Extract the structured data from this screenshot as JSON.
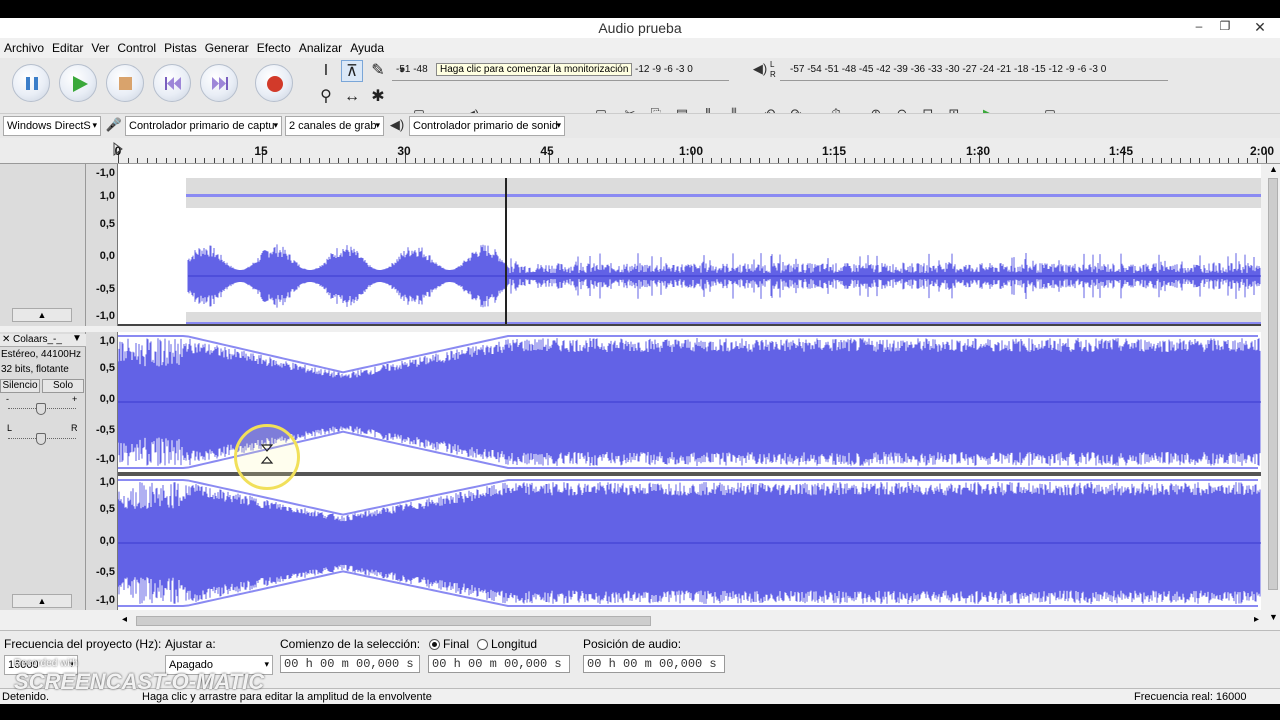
{
  "window": {
    "title": "Audio prueba",
    "minimize_glyph": "–",
    "restore_glyph": "❐",
    "close_glyph": "✕"
  },
  "menu": [
    "Archivo",
    "Editar",
    "Ver",
    "Control",
    "Pistas",
    "Generar",
    "Efecto",
    "Analizar",
    "Ayuda"
  ],
  "transport": {
    "buttons": [
      "pause-icon",
      "play-icon",
      "stop-icon",
      "skip-start-icon",
      "skip-end-icon",
      "record-icon"
    ]
  },
  "tools": [
    "selection-icon",
    "envelope-icon",
    "draw-icon",
    "zoom-icon",
    "timeshift-icon",
    "multi-tool-icon"
  ],
  "record_meter": {
    "scale": "-51 -48",
    "tooltip": "Haga clic para comenzar la monitorización",
    "scale_right": "-12  -9  -6  -3  0"
  },
  "play_meter": {
    "scale": "-57 -54 -51 -48 -45 -42 -39 -36 -33 -30 -27 -24 -21 -18 -15 -12  -9  -6  -3  0",
    "lr_top": "L",
    "lr_bottom": "R"
  },
  "device_toolbar": {
    "host": "Windows DirectS",
    "recording_device": "Controlador primario de captu",
    "channels": "2 canales de grab",
    "playback_device": "Controlador primario de sonid"
  },
  "ruler": {
    "labels": [
      "0",
      "15",
      "30",
      "45",
      "1:00",
      "1:15",
      "1:30",
      "1:45",
      "2:00"
    ]
  },
  "track1": {
    "scale": [
      "-1,0",
      "1,0",
      "0,5",
      "0,0",
      "-0,5",
      "-1,0"
    ]
  },
  "track2": {
    "name": "Colaars_-_",
    "info1": "Estéreo, 44100Hz",
    "info2": "32 bits, flotante",
    "mute": "Silencio",
    "solo": "Solo",
    "gain_minus": "-",
    "gain_plus": "+",
    "pan_left": "L",
    "pan_right": "R",
    "scale_top": [
      "1,0",
      "0,5",
      "0,0",
      "-0,5",
      "-1,0"
    ],
    "scale_bottom": [
      "1,0",
      "0,5",
      "0,0",
      "-0,5",
      "-1,0"
    ]
  },
  "selection_bar": {
    "project_rate_label": "Frecuencia del proyecto (Hz):",
    "project_rate": "16000",
    "snap_label": "Ajustar a:",
    "snap_value": "Apagado",
    "sel_start_label": "Comienzo de la selección:",
    "end_label": "Final",
    "length_label": "Longitud",
    "audio_pos_label": "Posición de audio:",
    "time_start": "00 h 00 m 00,000 s",
    "time_end": "00 h 00 m 00,000 s",
    "time_pos": "00 h 00 m 00,000 s"
  },
  "status": {
    "left": "Detenido.",
    "center": "Haga clic y arrastre para editar la amplitud de la envolvente",
    "right": "Frecuencia real: 16000"
  },
  "watermark": {
    "recorded_with": "Recorded with",
    "brand": "SCREENCAST-O-MATIC"
  },
  "colors": {
    "waveform": "#6262e6",
    "waveform_dark": "#3a3ad0",
    "clip_bg": "#dcdcdc",
    "envelope_line": "#8a8af2"
  }
}
